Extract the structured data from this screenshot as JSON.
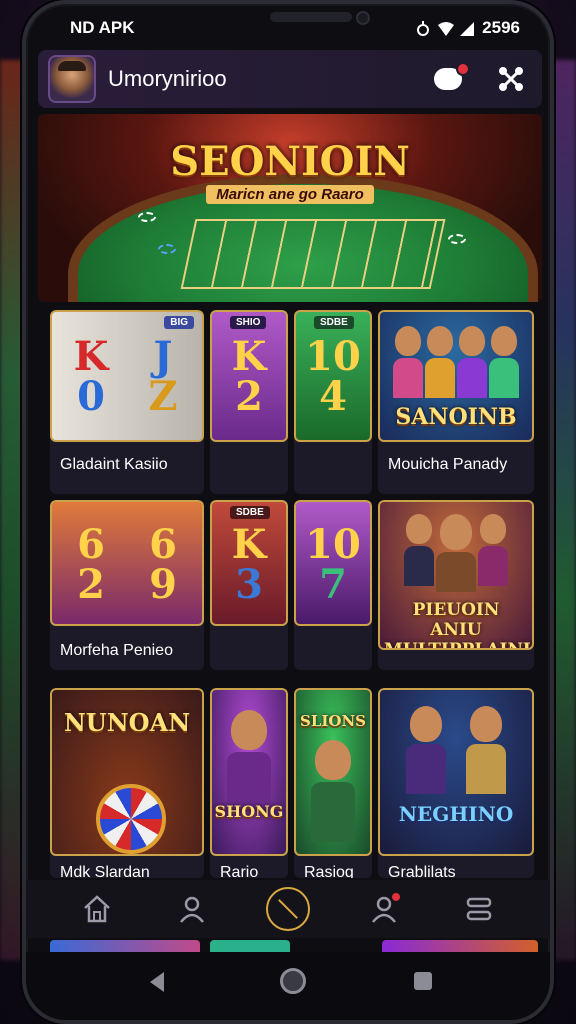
{
  "statusbar": {
    "left_text": "ND APK",
    "time": "2596"
  },
  "appbar": {
    "title": "Umorynirioo"
  },
  "hero": {
    "title": "SEONIOIN",
    "subtitle": "Maricn ane go Raaro"
  },
  "games": [
    {
      "label": "Gladaint Kasiio",
      "tag": "BIG"
    },
    {
      "label": "",
      "tag": "SHIO"
    },
    {
      "label": "",
      "tag": "SDBE"
    },
    {
      "label": "Mouicha Panady",
      "poster": "SANOINB"
    },
    {
      "label": "Morfeha Penieo",
      "tag": ""
    },
    {
      "label": "",
      "tag": "SDBE"
    },
    {
      "label": "",
      "tag": ""
    },
    {
      "label": "",
      "poster": "PIEUOIN ANIU MULTIPPLAINUS"
    },
    {
      "label": "Mdk Slardan",
      "poster": "NUNOAN"
    },
    {
      "label": "Rario",
      "poster": "SHONG"
    },
    {
      "label": "Rasiog",
      "poster": "SLIONS"
    },
    {
      "label": "Grablilats",
      "poster": "NEGHINO"
    }
  ],
  "reels": {
    "slot1": [
      "K",
      "0"
    ],
    "slot1b": [
      "J",
      "Z"
    ],
    "slot2": [
      "K",
      "2"
    ],
    "slot3": [
      "10",
      "4"
    ],
    "slot4": [
      "6",
      "2"
    ],
    "slot4b": [
      "6",
      "9"
    ],
    "slot5": [
      "K",
      "3"
    ],
    "slot6": [
      "10",
      "7"
    ]
  },
  "colors": {
    "accent": "#d9a840",
    "badge": "#e0313d",
    "card_border": "#c9a24a"
  },
  "nav": [
    "home-icon",
    "profile-icon",
    "wheel-icon",
    "notifications-icon",
    "menu-icon"
  ]
}
